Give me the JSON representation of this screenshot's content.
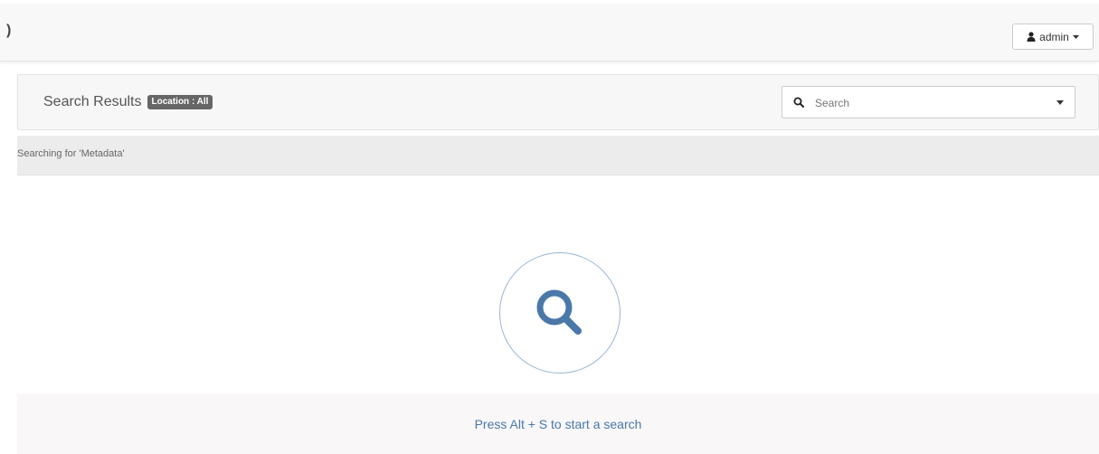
{
  "navbar": {
    "edge_glyph": ")",
    "user_button": {
      "label": "admin",
      "icon": "user-icon",
      "caret_icon": "caret-down-icon"
    }
  },
  "results": {
    "title": "Search Results",
    "location_badge": "Location : All",
    "search": {
      "placeholder": "Search",
      "value": "",
      "icon": "search-icon",
      "dropdown_icon": "caret-down-icon"
    }
  },
  "status": {
    "text": "Searching for 'Metadata'"
  },
  "empty_state": {
    "icon": "search-icon",
    "hint": "Press Alt + S to start a search"
  },
  "colors": {
    "accent": "#4a78a8",
    "badge": "#666666",
    "panel": "#f7f7f7",
    "strip": "#ececec"
  }
}
